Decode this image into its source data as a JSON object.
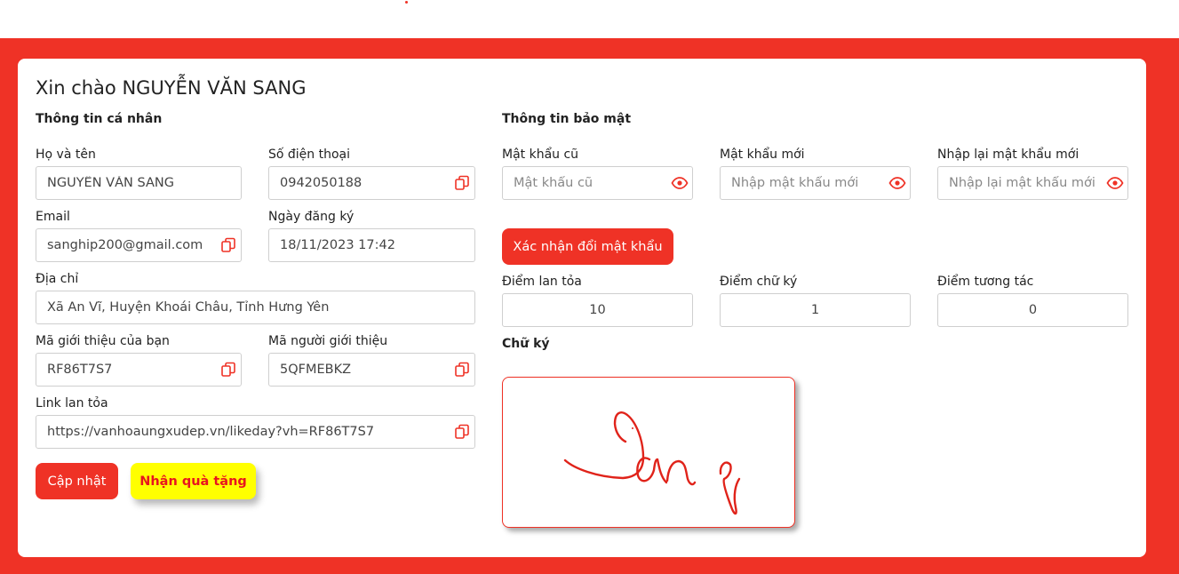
{
  "greeting": "Xin chào NGUYỄN VĂN SANG",
  "personal": {
    "title": "Thông tin cá nhân",
    "full_name_label": "Họ và tên",
    "full_name_value": "NGUYỄN VĂN SANG",
    "phone_label": "Số điện thoại",
    "phone_value": "0942050188",
    "email_label": "Email",
    "email_value": "sanghip200@gmail.com",
    "register_date_label": "Ngày đăng ký",
    "register_date_value": "18/11/2023 17:42",
    "address_label": "Địa chỉ",
    "address_value": "Xã An Vĩ, Huyện Khoái Châu, Tỉnh Hưng Yên",
    "my_referral_label": "Mã giới thiệu của bạn",
    "my_referral_value": "RF86T7S7",
    "referrer_label": "Mã người giới thiệu",
    "referrer_value": "5QFMEBKZ",
    "share_link_label": "Link lan tỏa",
    "share_link_value": "https://vanhoaungxudep.vn/likeday?vh=RF86T7S7",
    "update_button": "Cập nhật",
    "gift_button": "Nhận quà tặng"
  },
  "security": {
    "title": "Thông tin bảo mật",
    "old_password_label": "Mật khẩu cũ",
    "old_password_placeholder": "Mật khẩu cũ",
    "new_password_label": "Mật khẩu mới",
    "new_password_placeholder": "Nhập mật khẩu mới",
    "confirm_password_label": "Nhập lại mật khẩu mới",
    "confirm_password_placeholder": "Nhập lại mật khẩu mới",
    "confirm_button": "Xác nhận đổi mật khẩu"
  },
  "points": {
    "spread_label": "Điểm lan tỏa",
    "spread_value": "10",
    "signature_label": "Điểm chữ ký",
    "signature_value": "1",
    "interaction_label": "Điểm tương tác",
    "interaction_value": "0"
  },
  "signature": {
    "title": "Chữ ký",
    "ink_color": "#e0231a"
  },
  "colors": {
    "accent": "#ef3226",
    "gift_bg": "#ffff00",
    "gift_text": "#e8141f"
  }
}
